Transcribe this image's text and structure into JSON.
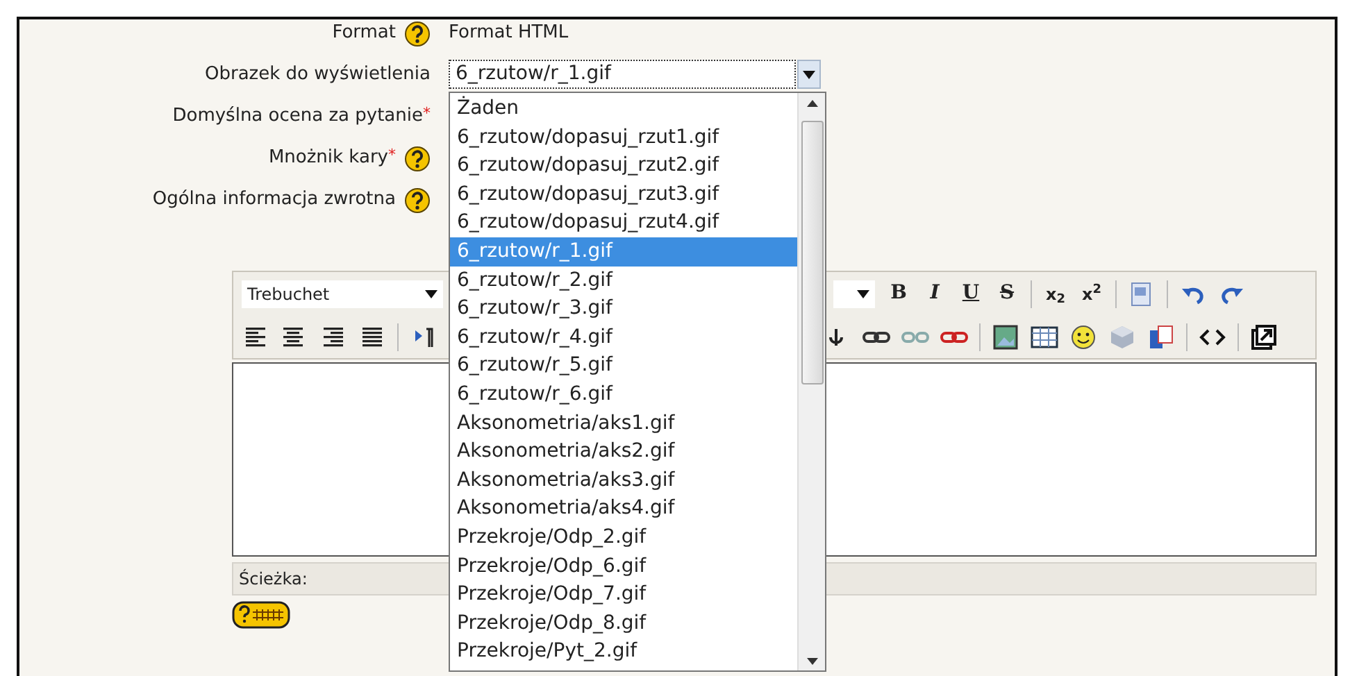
{
  "form": {
    "rows": [
      {
        "label": "Format",
        "required_mark": "",
        "help": true,
        "value": "Format HTML",
        "kind": "text"
      },
      {
        "label": "Obrazek do wyświetlenia",
        "required_mark": "",
        "help": false,
        "value": "6_rzutow/r_1.gif",
        "kind": "select"
      },
      {
        "label": "Domyślna ocena za pytanie",
        "required_mark": "*",
        "help": false,
        "kind": "none"
      },
      {
        "label": "Mnożnik kary",
        "required_mark": "*",
        "help": true,
        "kind": "none"
      },
      {
        "label": "Ogólna informacja zwrotna",
        "required_mark": "",
        "help": true,
        "kind": "none"
      }
    ]
  },
  "dropdown": {
    "expanded": true,
    "options": [
      {
        "label": "Żaden",
        "selected": false
      },
      {
        "label": "6_rzutow/dopasuj_rzut1.gif",
        "selected": false
      },
      {
        "label": "6_rzutow/dopasuj_rzut2.gif",
        "selected": false
      },
      {
        "label": "6_rzutow/dopasuj_rzut3.gif",
        "selected": false
      },
      {
        "label": "6_rzutow/dopasuj_rzut4.gif",
        "selected": false
      },
      {
        "label": "6_rzutow/r_1.gif",
        "selected": true
      },
      {
        "label": "6_rzutow/r_2.gif",
        "selected": false
      },
      {
        "label": "6_rzutow/r_3.gif",
        "selected": false
      },
      {
        "label": "6_rzutow/r_4.gif",
        "selected": false
      },
      {
        "label": "6_rzutow/r_5.gif",
        "selected": false
      },
      {
        "label": "6_rzutow/r_6.gif",
        "selected": false
      },
      {
        "label": "Aksonometria/aks1.gif",
        "selected": false
      },
      {
        "label": "Aksonometria/aks2.gif",
        "selected": false
      },
      {
        "label": "Aksonometria/aks3.gif",
        "selected": false
      },
      {
        "label": "Aksonometria/aks4.gif",
        "selected": false
      },
      {
        "label": "Przekroje/Odp_2.gif",
        "selected": false
      },
      {
        "label": "Przekroje/Odp_6.gif",
        "selected": false
      },
      {
        "label": "Przekroje/Odp_7.gif",
        "selected": false
      },
      {
        "label": "Przekroje/Odp_8.gif",
        "selected": false
      },
      {
        "label": "Przekroje/Pyt_2.gif",
        "selected": false
      }
    ]
  },
  "editor": {
    "font_select": "Trebuchet",
    "format_buttons": [
      "B",
      "I",
      "U",
      "S"
    ],
    "script_buttons": [
      "x$_{2}$",
      "x$^{2}$"
    ],
    "path_label": "Ścieżka:"
  }
}
